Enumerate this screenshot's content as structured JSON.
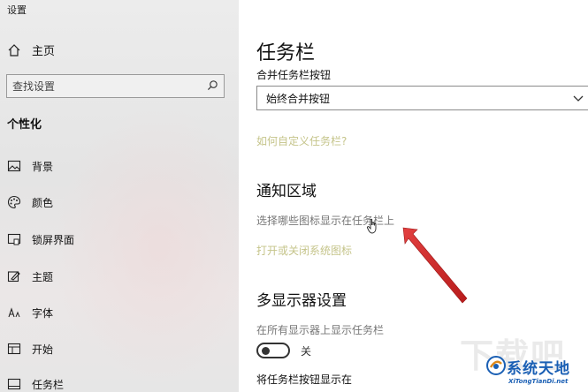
{
  "window": {
    "title": "设置"
  },
  "sidebar": {
    "home_label": "主页",
    "search_placeholder": "查找设置",
    "section_title": "个性化",
    "items": [
      {
        "label": "背景",
        "icon": "image-icon"
      },
      {
        "label": "颜色",
        "icon": "palette-icon"
      },
      {
        "label": "锁屏界面",
        "icon": "lockscreen-icon"
      },
      {
        "label": "主题",
        "icon": "theme-icon"
      },
      {
        "label": "字体",
        "icon": "font-icon"
      },
      {
        "label": "开始",
        "icon": "start-icon"
      },
      {
        "label": "任务栏",
        "icon": "taskbar-icon"
      }
    ]
  },
  "main": {
    "title": "任务栏",
    "combine_label": "合并任务栏按钮",
    "combine_value": "始终合并按钮",
    "customize_link": "如何自定义任务栏?",
    "notification_heading": "通知区域",
    "select_icons_text": "选择哪些图标显示在任务栏上",
    "system_icons_link": "打开或关闭系统图标",
    "multi_display_heading": "多显示器设置",
    "show_all_displays_label": "在所有显示器上显示任务栏",
    "toggle_state": "关",
    "show_buttons_on_label": "将任务栏按钮显示在"
  },
  "watermark": {
    "text": "系统天地",
    "sub": "XiTongTianDi.net"
  },
  "colors": {
    "link": "#c5c48a",
    "arrow": "#d42a2a",
    "watermark": "#1a5fb4"
  }
}
